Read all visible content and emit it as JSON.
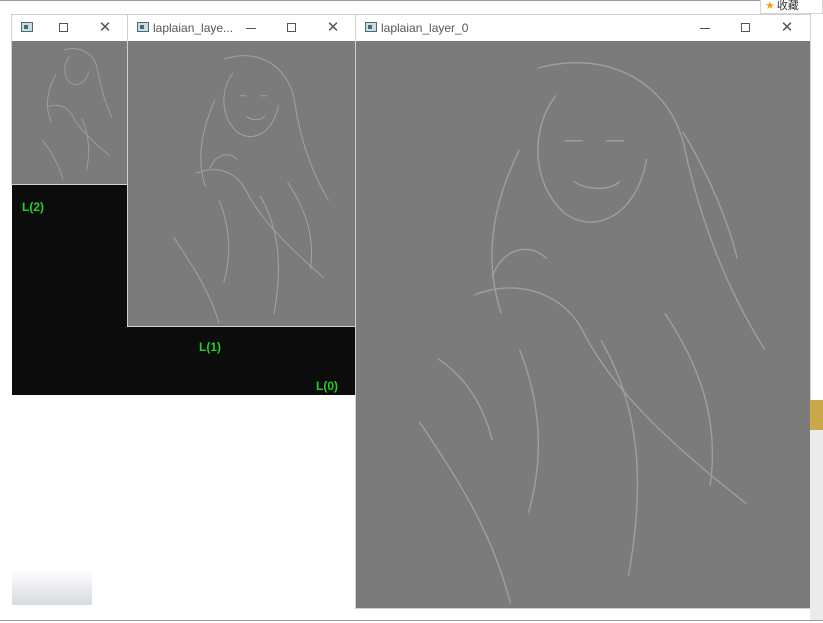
{
  "bookmark": {
    "star_icon": "star-icon",
    "label": "收藏"
  },
  "windows": [
    {
      "id": "w2",
      "title": "",
      "icon": "app-icon"
    },
    {
      "id": "w1",
      "title": "laplaian_laye...",
      "icon": "app-icon"
    },
    {
      "id": "w0",
      "title": "laplaian_layer_0",
      "icon": "app-icon"
    }
  ],
  "controls": {
    "minimize": "minimize-icon",
    "maximize": "maximize-icon",
    "close": "close-icon",
    "close_glyph": "✕"
  },
  "labels": {
    "l2": "L(2)",
    "l1": "L(1)",
    "l0": "L(0)"
  },
  "colors": {
    "image_gray": "#7b7b7b",
    "label_green": "#25d025",
    "black_bg": "#0c0c0c"
  }
}
